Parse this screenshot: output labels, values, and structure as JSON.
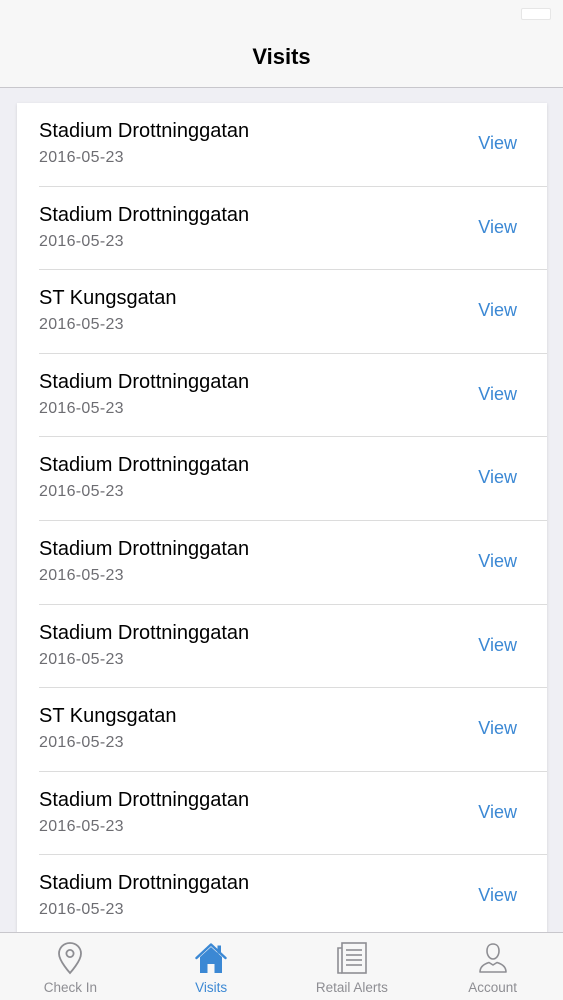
{
  "nav": {
    "title": "Visits"
  },
  "visits": [
    {
      "name": "Stadium Drottninggatan",
      "date": "2016-05-23",
      "action": "View"
    },
    {
      "name": "Stadium Drottninggatan",
      "date": "2016-05-23",
      "action": "View"
    },
    {
      "name": "ST Kungsgatan",
      "date": "2016-05-23",
      "action": "View"
    },
    {
      "name": "Stadium Drottninggatan",
      "date": "2016-05-23",
      "action": "View"
    },
    {
      "name": "Stadium Drottninggatan",
      "date": "2016-05-23",
      "action": "View"
    },
    {
      "name": "Stadium Drottninggatan",
      "date": "2016-05-23",
      "action": "View"
    },
    {
      "name": "Stadium Drottninggatan",
      "date": "2016-05-23",
      "action": "View"
    },
    {
      "name": "ST Kungsgatan",
      "date": "2016-05-23",
      "action": "View"
    },
    {
      "name": "Stadium Drottninggatan",
      "date": "2016-05-23",
      "action": "View"
    },
    {
      "name": "Stadium Drottninggatan",
      "date": "2016-05-23",
      "action": "View"
    }
  ],
  "tabs": [
    {
      "label": "Check In",
      "icon": "location-pin-icon",
      "active": false
    },
    {
      "label": "Visits",
      "icon": "home-icon",
      "active": true
    },
    {
      "label": "Retail Alerts",
      "icon": "document-list-icon",
      "active": false
    },
    {
      "label": "Account",
      "icon": "person-icon",
      "active": false
    }
  ],
  "colors": {
    "accent": "#3b88d4",
    "inactive": "#8e8e93",
    "background": "#efeff4"
  }
}
